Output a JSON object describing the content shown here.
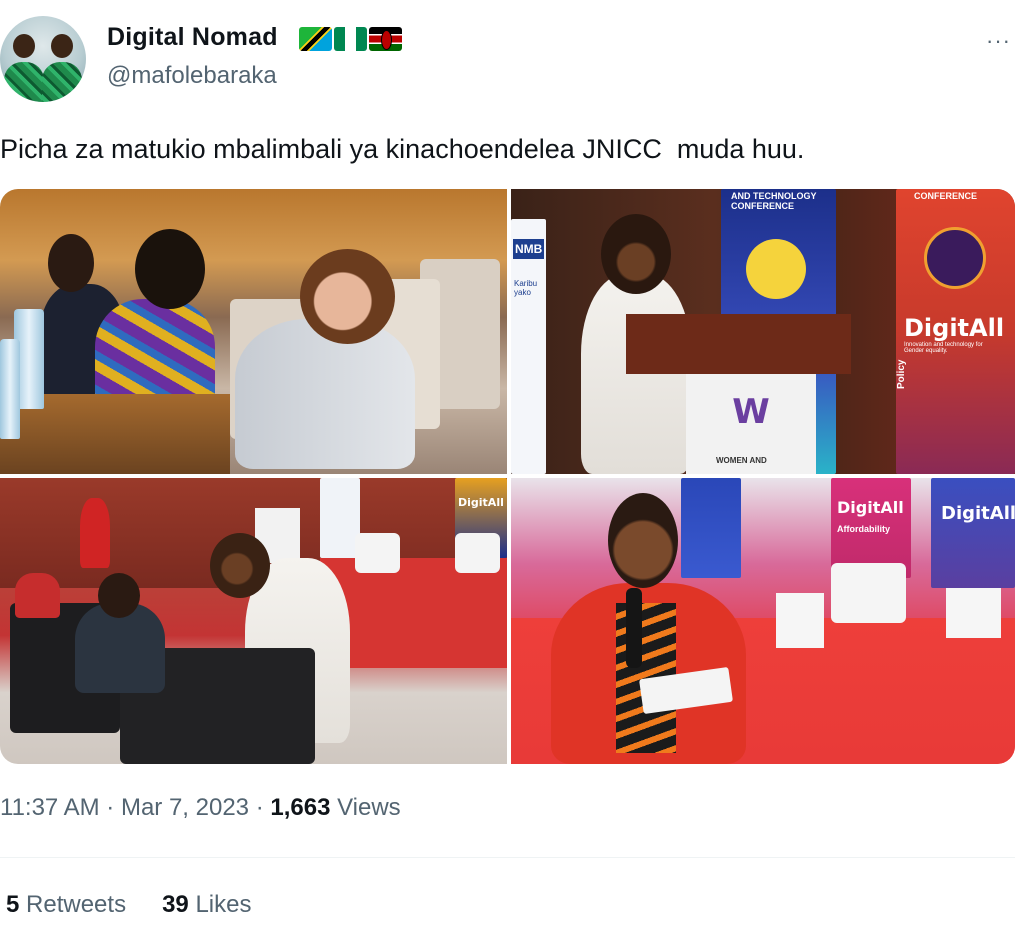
{
  "author": {
    "name": "Digital Nomad",
    "handle": "@mafolebaraka",
    "flags": [
      "flag-tanzania-icon",
      "flag-nigeria-icon",
      "flag-kenya-icon"
    ]
  },
  "more_icon": "···",
  "tweet": {
    "text": "Picha za matukio mbalimbali ya kinachoendelea JNICC  muda huu."
  },
  "media": {
    "photo2": {
      "banner_left": "NMB",
      "banner_left_sub": "Karibu yako",
      "banner_mid": "AND TECHNOLOGY CONFERENCE",
      "banner_right_top": "CONFERENCE",
      "brand": "DigitAll",
      "brand_sub": "Innovation and technology for Gender equality.",
      "policy": "Policy",
      "podium_text": "WOMEN AND"
    },
    "photo3": {
      "brand": "DigitAll"
    },
    "photo4": {
      "brand_left": "DigitAll",
      "brand_left_sub": "Affordability",
      "brand_right": "DigitAll"
    }
  },
  "meta": {
    "time": "11:37 AM",
    "separator": " · ",
    "date": "Mar 7, 2023",
    "views_count": "1,663",
    "views_label": " Views"
  },
  "stats": {
    "retweets_count": "5",
    "retweets_label": " Retweets",
    "likes_count": "39",
    "likes_label": " Likes"
  },
  "colors": {
    "text_primary": "#0f1419",
    "text_secondary": "#536471",
    "divider": "#eff3f4"
  }
}
